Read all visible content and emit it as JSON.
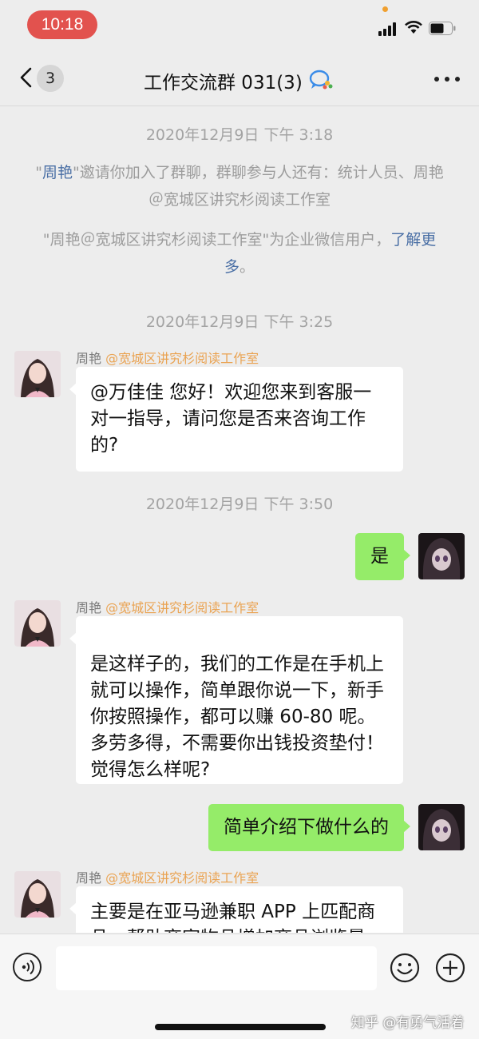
{
  "status_bar": {
    "time": "10:18"
  },
  "nav": {
    "back_badge": "3",
    "title": "工作交流群 031(3)"
  },
  "system": {
    "ts1": "2020年12月9日 下午 3:18",
    "invite_q1": "\"",
    "invite_name": "周艳",
    "invite_rest": "\"邀请你加入了群聊，群聊参与人还有：统计人员、周艳＠宽城区讲究杉阅读工作室",
    "enterprise_text": "\"周艳＠宽城区讲究杉阅读工作室\"为企业微信用户，",
    "enterprise_link": "了解更多",
    "enterprise_end": "。",
    "ts2": "2020年12月9日 下午 3:25",
    "ts3": "2020年12月9日 下午 3:50"
  },
  "messages": {
    "sender_name": "周艳",
    "sender_org": "@宽城区讲究杉阅读工作室",
    "m1": "@万佳佳 您好！欢迎您来到客服一对一指导，请问您是否来咨询工作的?",
    "m2": "是",
    "m3": "是这样子的，我们的工作是在手机上就可以操作，简单跟你说一下，新手你按照操作，都可以赚 60-80 呢。多劳多得，不需要你出钱投资垫付！觉得怎么样呢?",
    "m4": "简单介绍下做什么的",
    "m5": "主要是在亚马逊兼职 APP 上匹配商品，帮助商家物品增加商品浏览量"
  },
  "input_bar": {
    "watermark": "知乎 @有勇气活着"
  },
  "colors": {
    "sent_bubble": "#95ec69",
    "received_bubble": "#ffffff",
    "org_tag": "#eaa352",
    "link": "#4a6fa5",
    "time_pill": "#e2524e"
  }
}
